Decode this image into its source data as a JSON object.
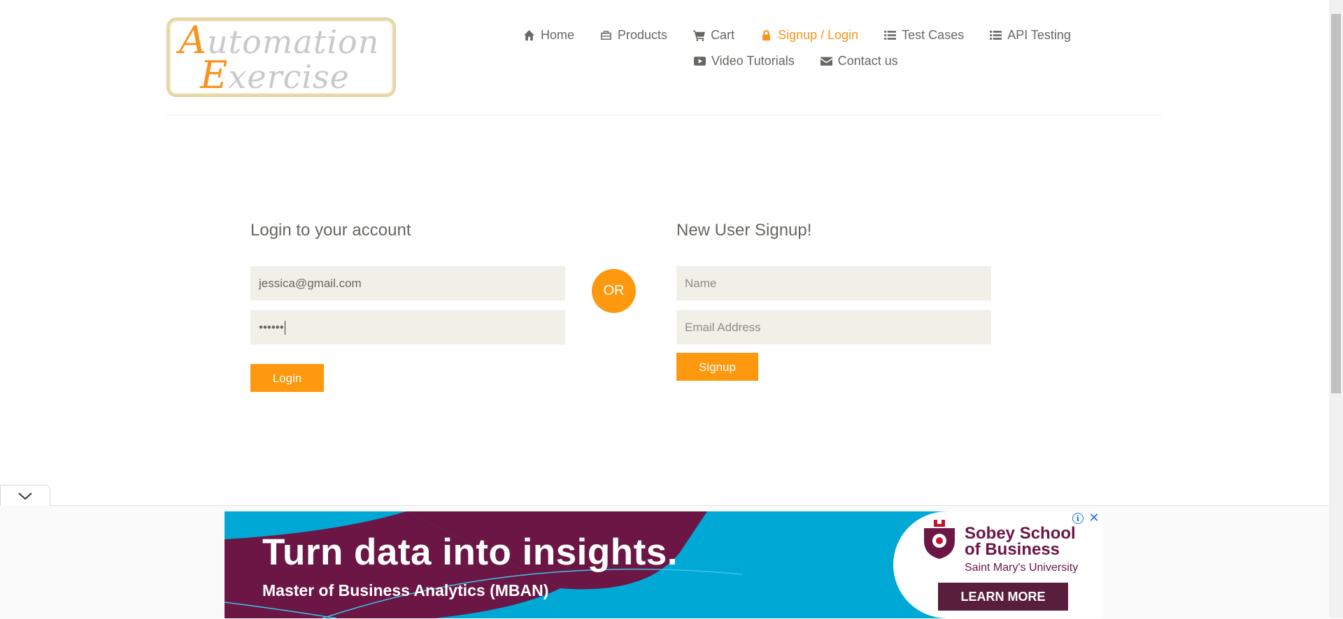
{
  "logo": {
    "line1_cap": "A",
    "line1_rest": "utomation",
    "line2_cap": "E",
    "line2_rest": "xercise"
  },
  "nav": {
    "row1": [
      {
        "label": "Home",
        "icon": "home-icon",
        "active": false
      },
      {
        "label": "Products",
        "icon": "briefcase-icon",
        "active": false
      },
      {
        "label": "Cart",
        "icon": "cart-icon",
        "active": false
      },
      {
        "label": "Signup / Login",
        "icon": "lock-icon",
        "active": true
      },
      {
        "label": "Test Cases",
        "icon": "list-icon",
        "active": false
      },
      {
        "label": "API Testing",
        "icon": "list-icon",
        "active": false
      }
    ],
    "row2": [
      {
        "label": "Video Tutorials",
        "icon": "youtube-play-icon",
        "active": false
      },
      {
        "label": "Contact us",
        "icon": "envelope-icon",
        "active": false
      }
    ]
  },
  "login": {
    "title": "Login to your account",
    "email_value": "jessica@gmail.com",
    "password_value": "••••••",
    "button": "Login"
  },
  "divider": {
    "or": "OR"
  },
  "signup": {
    "title": "New User Signup!",
    "name_placeholder": "Name",
    "email_placeholder": "Email Address",
    "button": "Signup"
  },
  "ad": {
    "headline": "Turn data into insights.",
    "subline": "Master of Business Analytics (MBAN)",
    "school": "Sobey School\nof Business",
    "university": "Saint Mary's University",
    "cta": "LEARN MORE",
    "info_glyph": "i",
    "close_glyph": "✕"
  },
  "colors": {
    "accent": "#fe980f",
    "text": "#696763",
    "input_bg": "#f0f0e9",
    "ad_blue": "#00a8d6",
    "ad_maroon": "#6b1645"
  }
}
